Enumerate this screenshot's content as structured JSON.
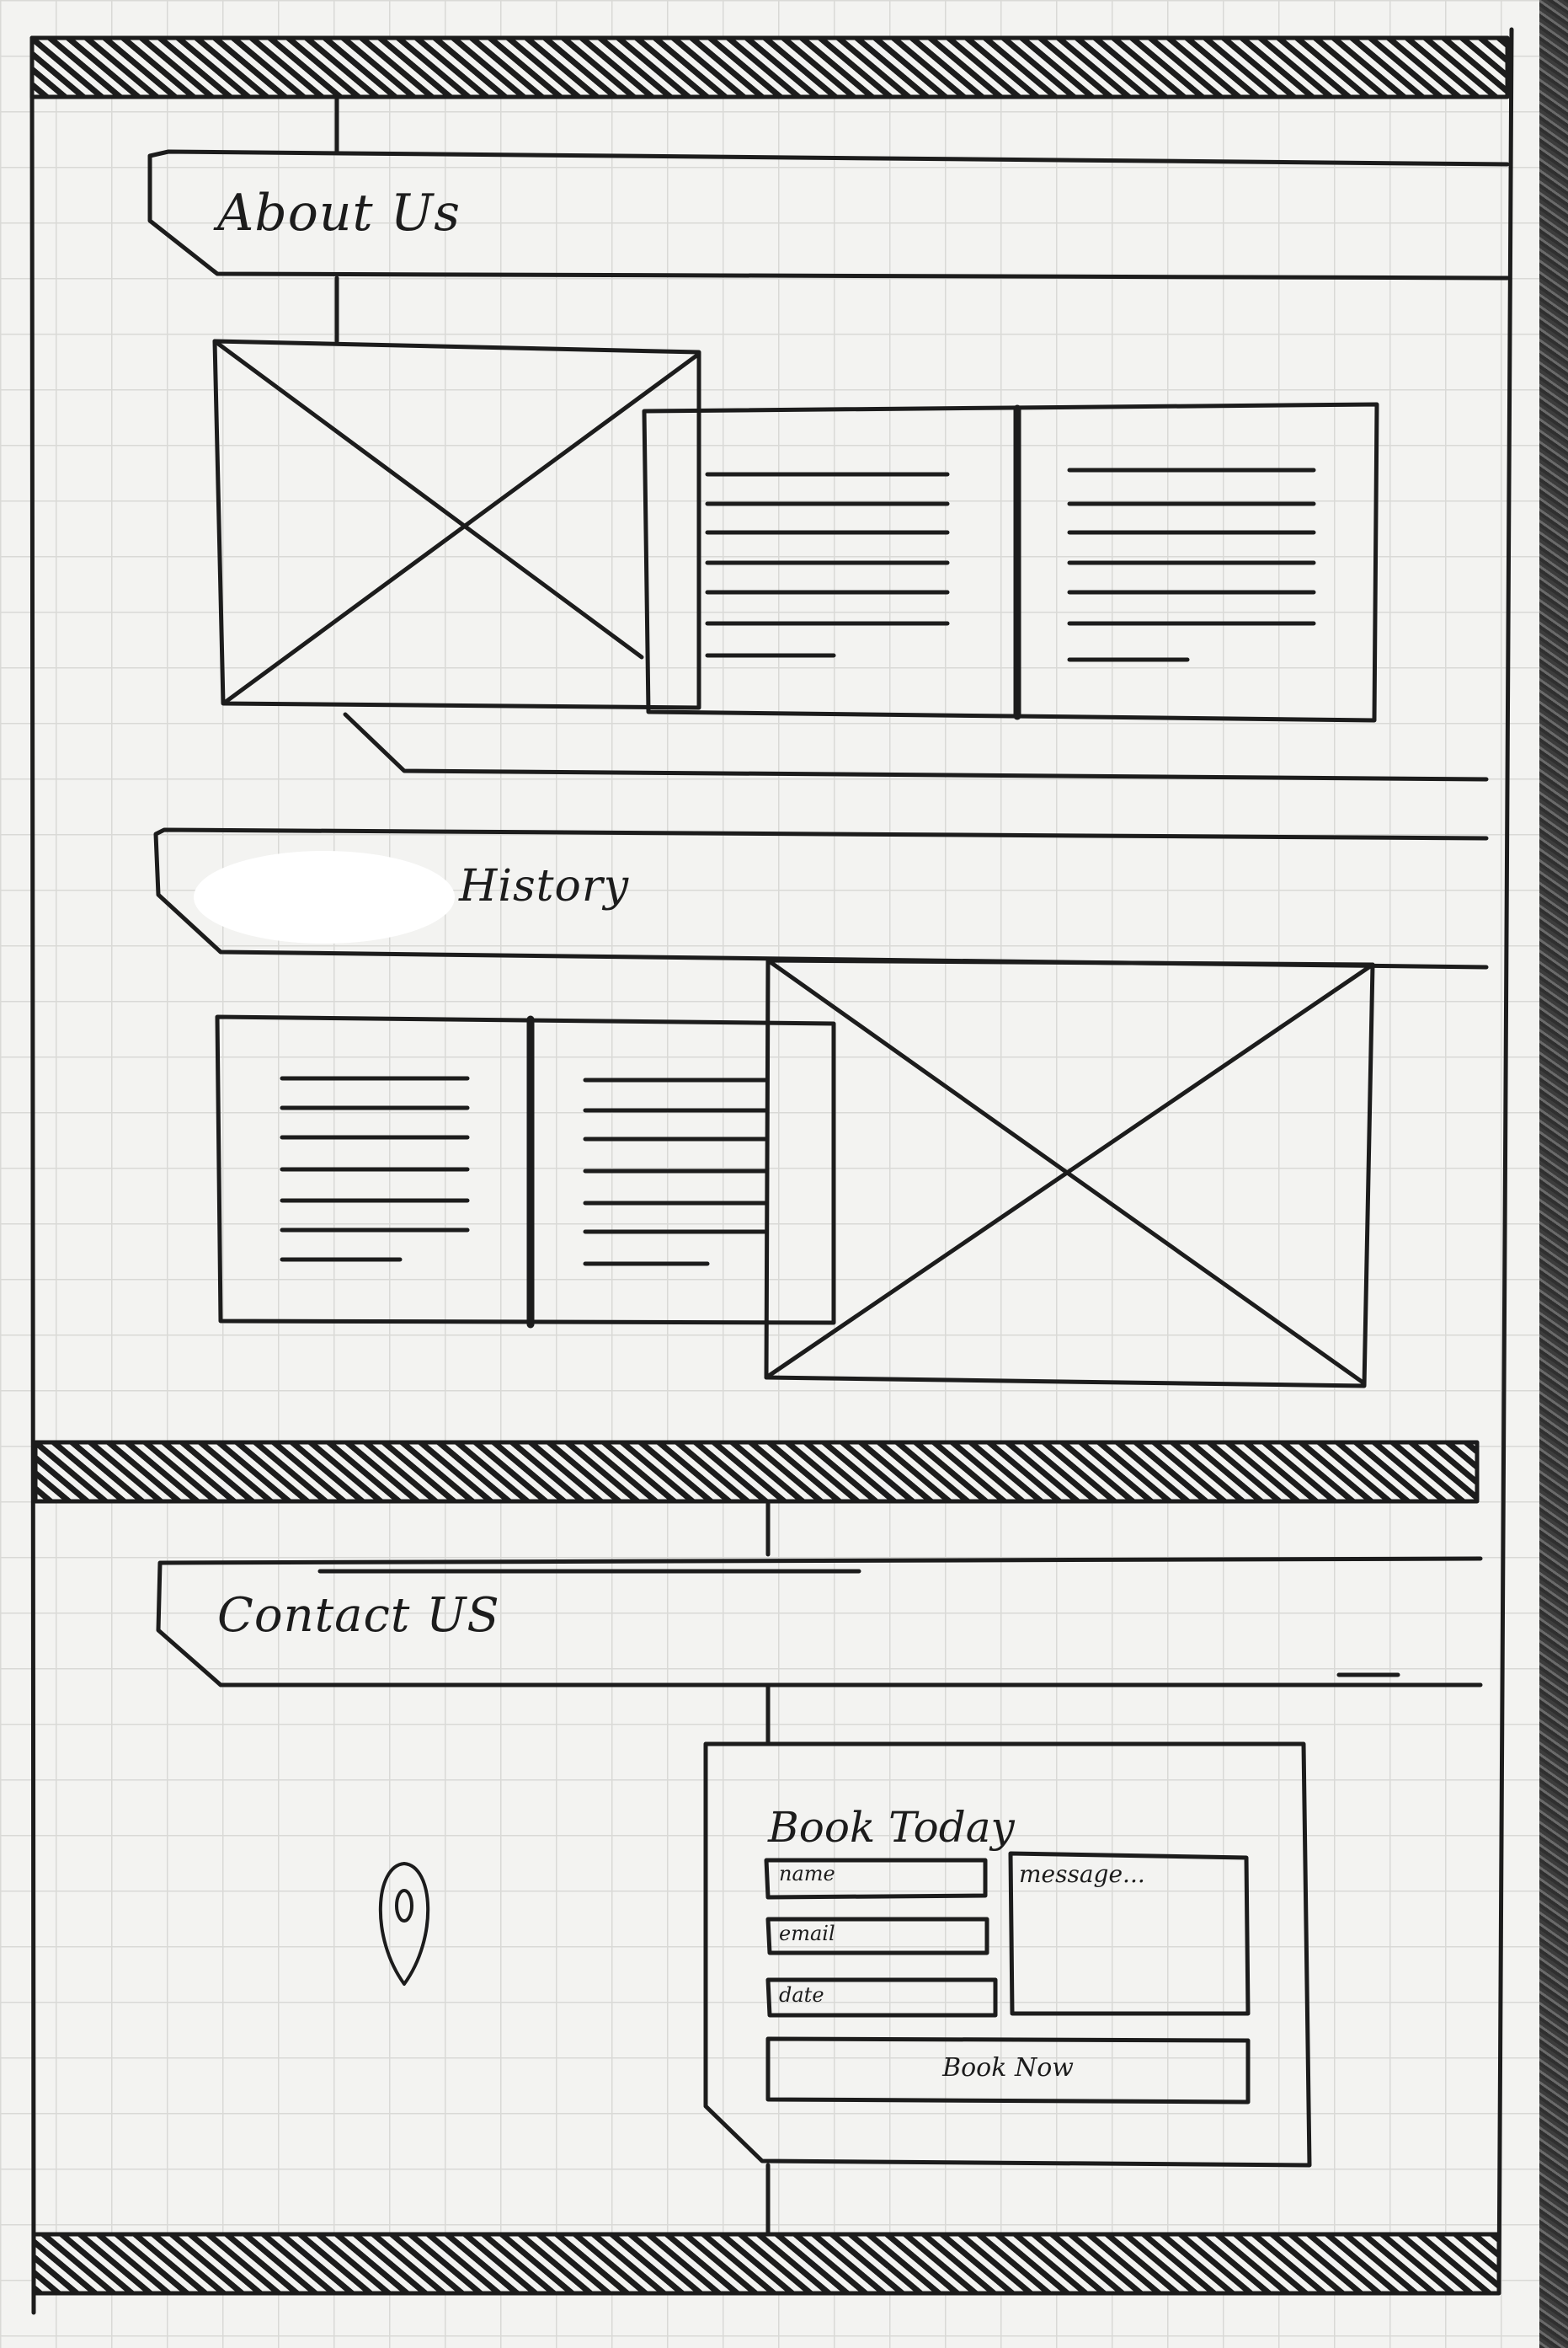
{
  "sections": {
    "about_title": "About Us",
    "history_title": "History",
    "contact_title": "Contact US"
  },
  "booking_form": {
    "title": "Book Today",
    "name_placeholder": "name",
    "email_placeholder": "email",
    "date_placeholder": "date",
    "message_placeholder": "message...",
    "submit_label": "Book Now"
  },
  "icons": {
    "location": "map-pin-icon",
    "image": "image-placeholder-icon"
  },
  "colors": {
    "ink": "#1c1c1c",
    "paper": "#f3f3f1",
    "grid": "#d9d9d6"
  }
}
